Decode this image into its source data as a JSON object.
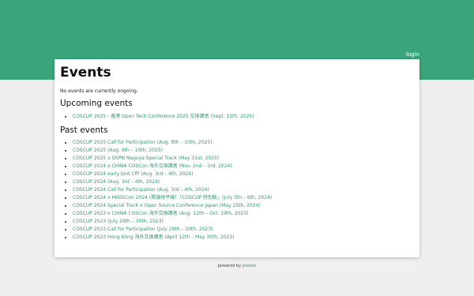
{
  "header": {
    "login_label": "login",
    "band_color": "#3aa57a"
  },
  "page": {
    "title": "Events",
    "status_text": "No events are currently ongoing."
  },
  "upcoming": {
    "heading": "Upcoming events",
    "items": [
      "COSCUP 2025 - 香港 Open Tech Conference 2025 交換講者 (Sept. 13th, 2025)"
    ]
  },
  "past": {
    "heading": "Past events",
    "items": [
      "COSCUP 2025 Call for Participation (Aug. 9th – 10th, 2025)",
      "COSCUP 2025 (Aug. 9th – 10th, 2025)",
      "COSCUP 2025 x OSPN Nagoya Special Track (May 31st, 2025)",
      "COSCUP 2024 x CHINA COSCon 海外交換講者 (Nov. 2nd – 3rd, 2024)",
      "COSCUP 2024 early bird CfP (Aug. 3rd – 4th, 2024)",
      "COSCUP 2024 (Aug. 3rd – 4th, 2024)",
      "COSCUP 2024 Call for Participation (Aug. 3rd – 4th, 2024)",
      "COSCUP 2024 x HKOSCon 2024 (開源地平線）「COSCUP 特別軌」(July 5th – 6th, 2024)",
      "COSCUP 2024 Special Track x Open Source Conference Japan (May 25th, 2024)",
      "COSCUP 2023 x CHINA COSCon 海外交換講者 (Aug. 12th – Oct. 29th, 2023)",
      "COSCUP 2023 (July 29th – 30th, 2023)",
      "COSCUP 2023 Call for Participation (July 29th – 30th, 2023)",
      "COSCUP 2023 Hong Kong 海外交換講者 (April 12th – May 30th, 2023)"
    ]
  },
  "footer": {
    "prefix": "powered by ",
    "link_label": "pretalx"
  }
}
